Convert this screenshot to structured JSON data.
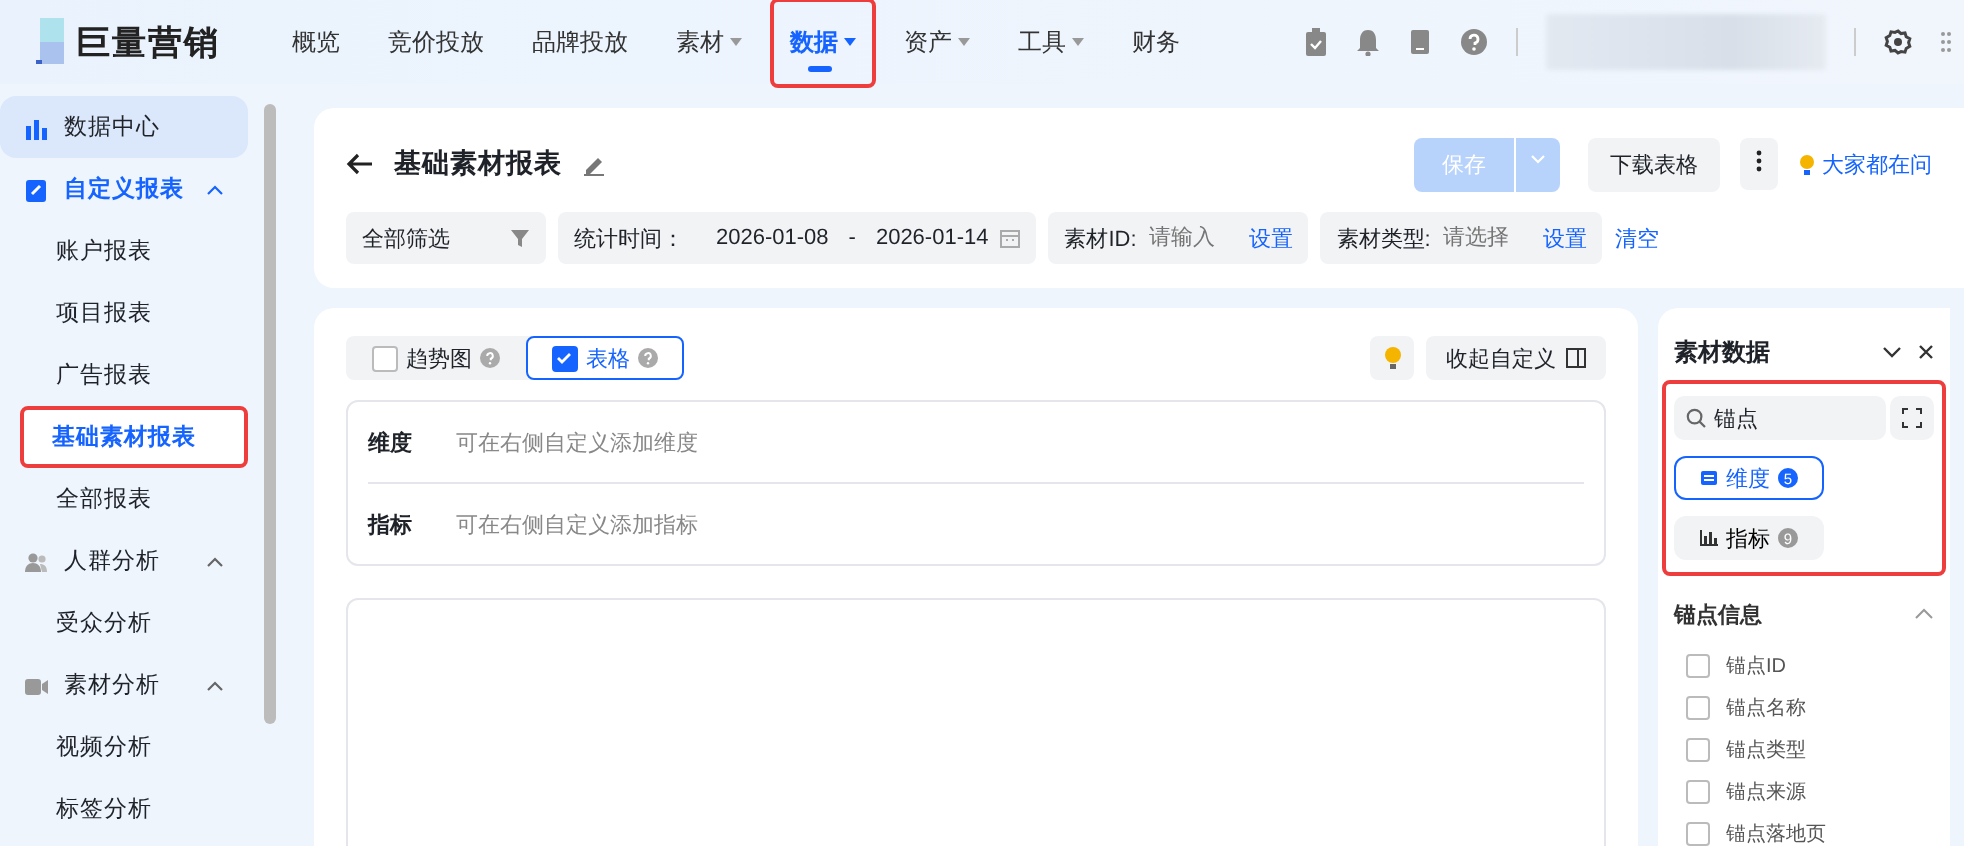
{
  "brand": {
    "name": "巨量营销"
  },
  "nav": [
    {
      "label": "概览",
      "dropdown": false,
      "selected": false,
      "highlighted": false
    },
    {
      "label": "竞价投放",
      "dropdown": false,
      "selected": false,
      "highlighted": false
    },
    {
      "label": "品牌投放",
      "dropdown": false,
      "selected": false,
      "highlighted": false
    },
    {
      "label": "素材",
      "dropdown": true,
      "selected": false,
      "highlighted": false
    },
    {
      "label": "数据",
      "dropdown": true,
      "selected": true,
      "highlighted": true
    },
    {
      "label": "资产",
      "dropdown": true,
      "selected": false,
      "highlighted": false
    },
    {
      "label": "工具",
      "dropdown": true,
      "selected": false,
      "highlighted": false
    },
    {
      "label": "财务",
      "dropdown": false,
      "selected": false,
      "highlighted": false
    }
  ],
  "sidebar": {
    "items": [
      {
        "kind": "link",
        "label": "数据中心",
        "selected": true
      },
      {
        "kind": "group",
        "label": "自定义报表",
        "active": true,
        "expanded": true,
        "children": [
          {
            "label": "账户报表",
            "selected": false,
            "highlighted": false
          },
          {
            "label": "项目报表",
            "selected": false,
            "highlighted": false
          },
          {
            "label": "广告报表",
            "selected": false,
            "highlighted": false
          },
          {
            "label": "基础素材报表",
            "selected": true,
            "highlighted": true
          },
          {
            "label": "全部报表",
            "selected": false,
            "highlighted": false
          }
        ]
      },
      {
        "kind": "group",
        "label": "人群分析",
        "active": false,
        "expanded": true,
        "children": [
          {
            "label": "受众分析",
            "selected": false,
            "highlighted": false
          }
        ]
      },
      {
        "kind": "group",
        "label": "素材分析",
        "active": false,
        "expanded": true,
        "children": [
          {
            "label": "视频分析",
            "selected": false,
            "highlighted": false
          },
          {
            "label": "标签分析",
            "selected": false,
            "highlighted": false
          }
        ]
      }
    ]
  },
  "report": {
    "title": "基础素材报表",
    "save": {
      "label": "保存",
      "disabled": true
    },
    "download": "下载表格",
    "faq": "大家都在问",
    "filters": {
      "all": "全部筛选",
      "time_label": "统计时间：",
      "start": "2026-01-08",
      "sep": "-",
      "end": "2026-01-14",
      "fields": [
        {
          "label": "素材ID:",
          "placeholder": "请输入",
          "action": "设置"
        },
        {
          "label": "素材类型:",
          "placeholder": "请选择",
          "action": "设置"
        }
      ],
      "clear": "清空"
    }
  },
  "view": {
    "modes": [
      {
        "label": "趋势图",
        "checked": false
      },
      {
        "label": "表格",
        "checked": true
      }
    ],
    "collapse": "收起自定义",
    "rows": [
      {
        "label": "维度",
        "hint": "可在右侧自定义添加维度"
      },
      {
        "label": "指标",
        "hint": "可在右侧自定义添加指标"
      }
    ]
  },
  "panel": {
    "title": "素材数据",
    "search": {
      "value": "锚点"
    },
    "highlighted": true,
    "tabs": [
      {
        "label": "维度",
        "count": "5",
        "selected": true
      },
      {
        "label": "指标",
        "count": "9",
        "selected": false
      }
    ],
    "section": {
      "title": "锚点信息",
      "expanded": true,
      "options": [
        {
          "label": "锚点ID",
          "checked": false
        },
        {
          "label": "锚点名称",
          "checked": false
        },
        {
          "label": "锚点类型",
          "checked": false
        },
        {
          "label": "锚点来源",
          "checked": false
        },
        {
          "label": "锚点落地页",
          "checked": false
        }
      ]
    }
  }
}
